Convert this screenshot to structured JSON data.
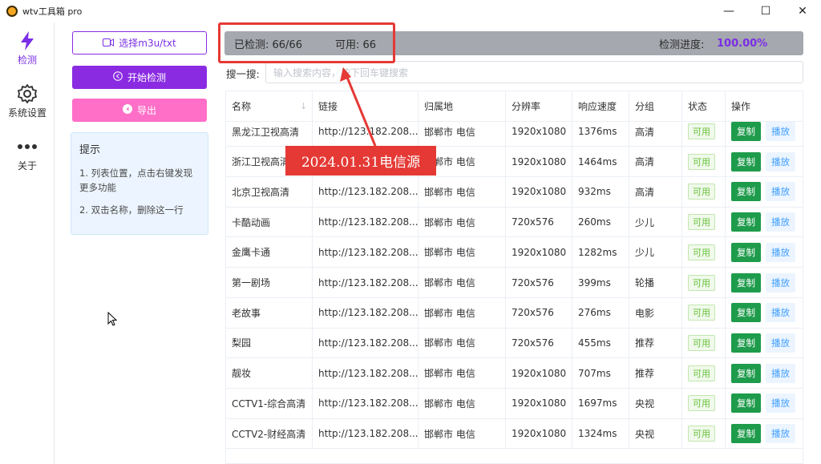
{
  "window": {
    "title": "wtv工具箱 pro",
    "controls": [
      "—",
      "☐",
      "✕"
    ]
  },
  "rail": [
    {
      "label": "检测",
      "icon": "lightning-icon",
      "active": true
    },
    {
      "label": "系统设置",
      "icon": "gear-icon",
      "active": false
    },
    {
      "label": "关于",
      "icon": "more-dots-icon",
      "active": false
    }
  ],
  "left_panel": {
    "select_label": "选择m3u/txt",
    "start_label": "开始检测",
    "export_label": "导出",
    "tips_title": "提示",
    "tips_1": "1. 列表位置，点击右键发现更多功能",
    "tips_2": "2. 双击名称，删除这一行"
  },
  "progress": {
    "checked": "已检测: 66/66",
    "available": "可用: 66",
    "label": "检测进度:",
    "value": "100.00%"
  },
  "search": {
    "label": "搜一搜:",
    "placeholder": "输入搜索内容，按下回车键搜索"
  },
  "table": {
    "headers": [
      "名称",
      "链接",
      "归属地",
      "分辨率",
      "响应速度",
      "分组",
      "状态",
      "操作"
    ],
    "status_label": "可用",
    "copy_label": "复制",
    "play_label": "播放",
    "rows": [
      {
        "name": "黑龙江卫视高清",
        "url": "http://123.182.208...",
        "loc": "邯郸市 电信",
        "res": "1920x1080",
        "speed": "1376ms",
        "group": "高清"
      },
      {
        "name": "浙江卫视高清",
        "url": "http://123.182.208...",
        "loc": "邯郸市 电信",
        "res": "1920x1080",
        "speed": "1464ms",
        "group": "高清"
      },
      {
        "name": "北京卫视高清",
        "url": "http://123.182.208...",
        "loc": "邯郸市 电信",
        "res": "1920x1080",
        "speed": "932ms",
        "group": "高清"
      },
      {
        "name": "卡酷动画",
        "url": "http://123.182.208...",
        "loc": "邯郸市 电信",
        "res": "720x576",
        "speed": "260ms",
        "group": "少儿"
      },
      {
        "name": "金鹰卡通",
        "url": "http://123.182.208...",
        "loc": "邯郸市 电信",
        "res": "1920x1080",
        "speed": "1282ms",
        "group": "少儿"
      },
      {
        "name": "第一剧场",
        "url": "http://123.182.208...",
        "loc": "邯郸市 电信",
        "res": "720x576",
        "speed": "399ms",
        "group": "轮播"
      },
      {
        "name": "老故事",
        "url": "http://123.182.208...",
        "loc": "邯郸市 电信",
        "res": "720x576",
        "speed": "276ms",
        "group": "电影"
      },
      {
        "name": "梨园",
        "url": "http://123.182.208...",
        "loc": "邯郸市 电信",
        "res": "720x576",
        "speed": "455ms",
        "group": "推荐"
      },
      {
        "name": "靓妆",
        "url": "http://123.182.208...",
        "loc": "邯郸市 电信",
        "res": "1920x1080",
        "speed": "707ms",
        "group": "推荐"
      },
      {
        "name": "CCTV1-综合高清",
        "url": "http://123.182.208...",
        "loc": "邯郸市 电信",
        "res": "1920x1080",
        "speed": "1697ms",
        "group": "央视"
      },
      {
        "name": "CCTV2-财经高清",
        "url": "http://123.182.208...",
        "loc": "邯郸市 电信",
        "res": "1920x1080",
        "speed": "1324ms",
        "group": "央视"
      }
    ]
  },
  "annotation": {
    "label": "2024.01.31电信源",
    "color": "#e53935"
  },
  "colors": {
    "accent": "#8a2be2",
    "export": "#ff6ec7",
    "copy": "#1e9b4b",
    "ok": "#67c23a"
  }
}
